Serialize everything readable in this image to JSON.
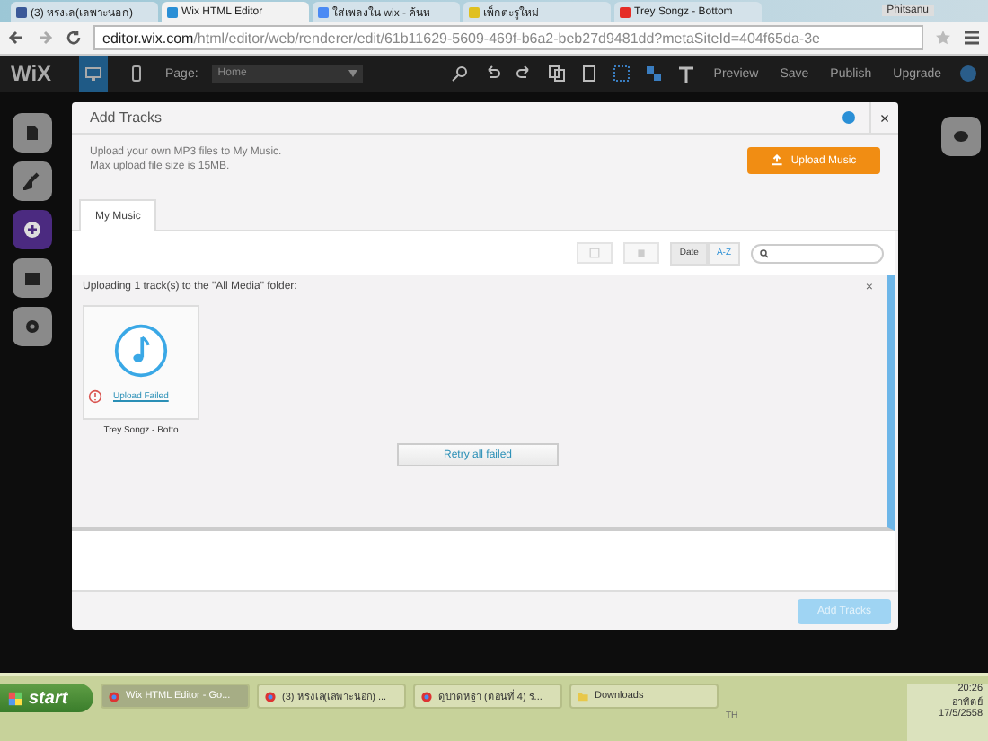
{
  "browser": {
    "tabs": [
      {
        "label": "(3) หรงเล(เลพาะนอก)",
        "selected": false
      },
      {
        "label": "Wix HTML Editor",
        "selected": true
      },
      {
        "label": "ใส่เพลงใน wix - ค้นห",
        "selected": false
      },
      {
        "label": "เพ็กตะรูใหม่",
        "selected": false
      },
      {
        "label": "Trey Songz - Bottom",
        "selected": false
      }
    ],
    "user_label": "Phitsanu",
    "url_host": "editor.wix.com",
    "url_path": "/html/editor/web/renderer/edit/61b11629-5609-469f-b6a2-beb27d9481dd?metaSiteId=404f65da-3e"
  },
  "editor_bar": {
    "logo": "WiX",
    "page_label": "Page:",
    "page_value": "Home",
    "devices": [
      {
        "kind": "desktop",
        "selected": true
      },
      {
        "kind": "mobile",
        "selected": false
      }
    ],
    "actions": [
      "Preview",
      "Save",
      "Publish",
      "Upgrade"
    ]
  },
  "dialog": {
    "title": "Add Tracks",
    "close": "×",
    "description": "Upload your own MP3 files to My Music.\nMax upload file size is 15MB.",
    "upload_button": "Upload Music",
    "tabs": [
      {
        "label": "My Music",
        "selected": true
      }
    ],
    "sort": [
      {
        "label": "Date",
        "selected": false
      },
      {
        "label": "A-Z",
        "selected": true
      }
    ],
    "upload_panel": {
      "heading": "Uploading 1 track(s) to the \"All Media\" folder:",
      "close": "×",
      "files": [
        {
          "name": "Trey Songz - Botto",
          "status": "Upload Failed",
          "failed": true
        }
      ],
      "retry_button": "Retry all failed"
    },
    "add_button": {
      "label": "Add Tracks",
      "disabled": true
    }
  },
  "taskbar": {
    "start": "start",
    "items": [
      {
        "label": "Wix HTML Editor - Go...",
        "selected": true,
        "kind": "browser"
      },
      {
        "label": "(3) หรงเล(เลพาะนอก) ...",
        "selected": false,
        "kind": "browser"
      },
      {
        "label": "ดูบาดหฐา (ตอนที่ 4) ร...",
        "selected": false,
        "kind": "browser"
      },
      {
        "label": "Downloads",
        "selected": false,
        "kind": "folder"
      }
    ],
    "language": "TH",
    "time": "20:26",
    "day": "อาทิตย์",
    "date": "17/5/2558"
  }
}
